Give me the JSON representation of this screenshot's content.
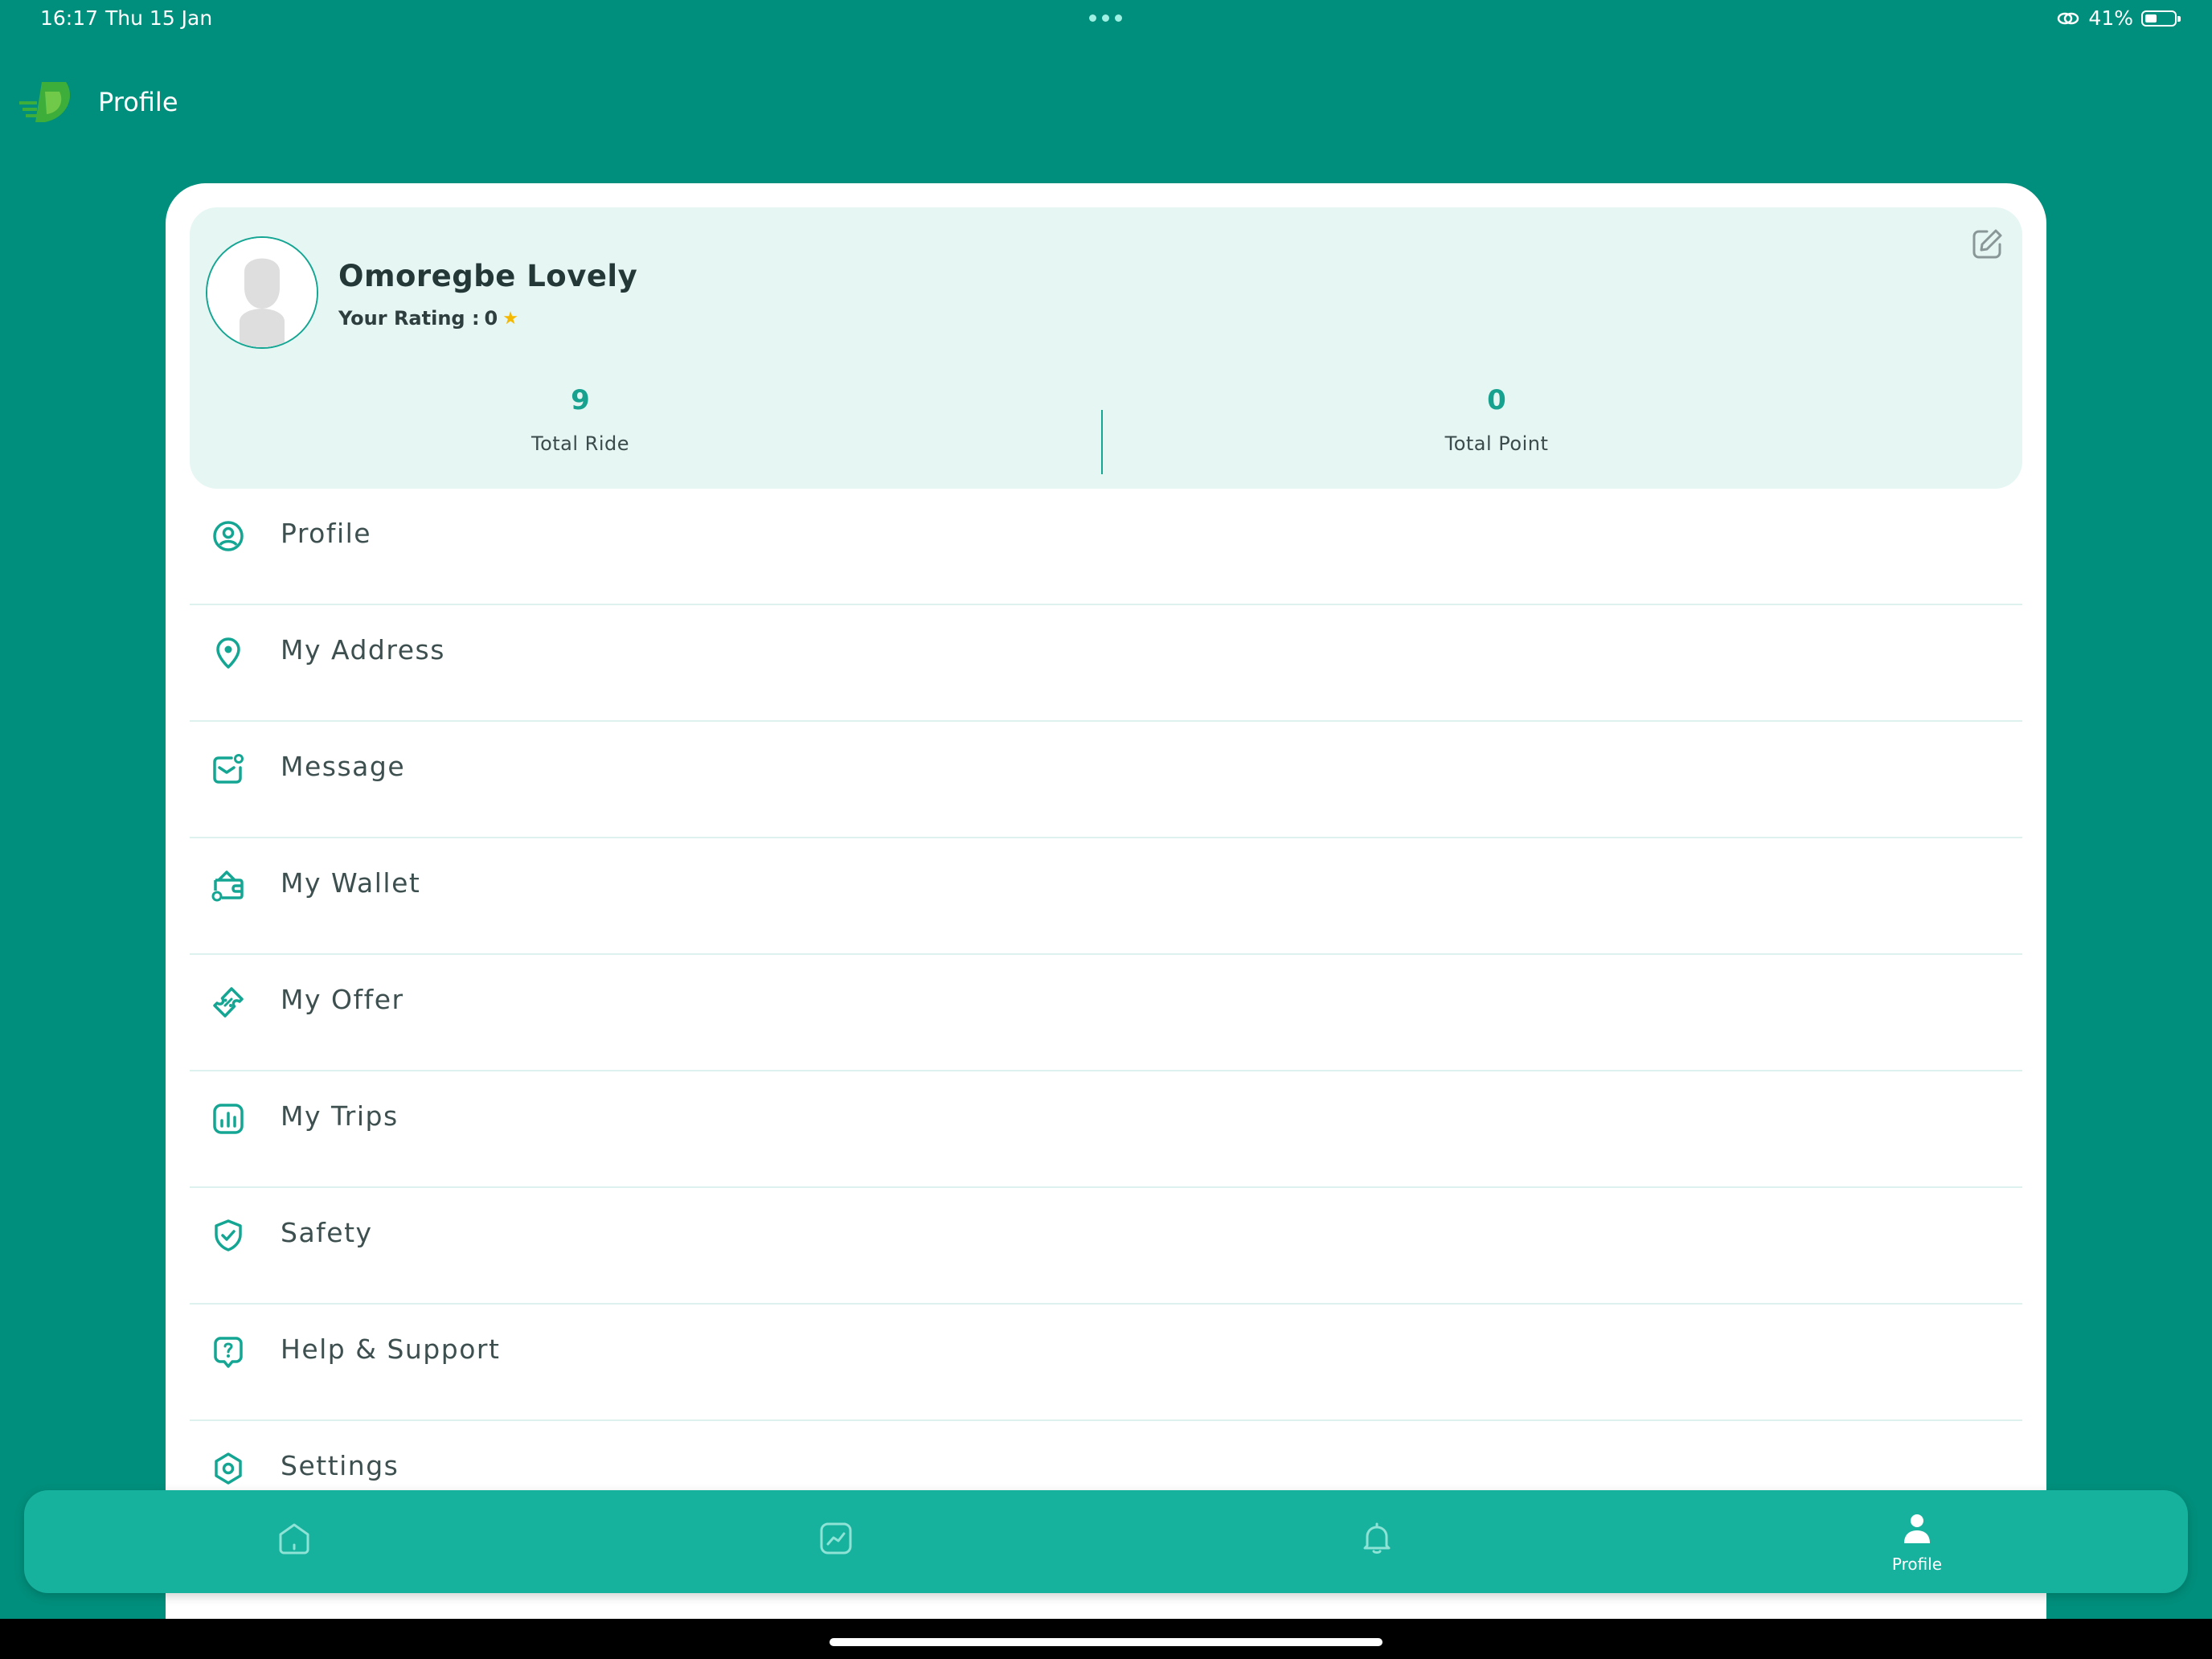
{
  "status_bar": {
    "time": "16:17",
    "date": "Thu 15 Jan",
    "battery": "41%",
    "battery_level": 0.41
  },
  "header": {
    "title": "Profile",
    "logo_icon": "app-logo-icon"
  },
  "profile": {
    "name": "Omoregbe Lovely",
    "rating_label": "Your Rating :",
    "rating_value": "0",
    "rating_icon": "star-icon",
    "stats": [
      {
        "value": "9",
        "label": "Total Ride"
      },
      {
        "value": "0",
        "label": "Total Point"
      }
    ]
  },
  "menu": {
    "items": [
      {
        "label": "Profile",
        "icon": "user-circle-icon"
      },
      {
        "label": "My Address",
        "icon": "location-pin-icon"
      },
      {
        "label": "Message",
        "icon": "message-icon"
      },
      {
        "label": "My Wallet",
        "icon": "wallet-icon"
      },
      {
        "label": "My Offer",
        "icon": "ticket-icon"
      },
      {
        "label": "My Trips",
        "icon": "trips-chart-icon"
      },
      {
        "label": "Safety",
        "icon": "shield-check-icon"
      },
      {
        "label": "Help & Support",
        "icon": "help-icon"
      },
      {
        "label": "Settings",
        "icon": "settings-icon"
      }
    ]
  },
  "bottom_nav": {
    "items": [
      {
        "label": "",
        "icon": "home-icon"
      },
      {
        "label": "",
        "icon": "activity-chart-icon"
      },
      {
        "label": "",
        "icon": "bell-icon"
      },
      {
        "label": "Profile",
        "icon": "profile-icon",
        "active": true
      }
    ]
  },
  "colors": {
    "background": "#008F7C",
    "accent": "#14A593",
    "nav_bar": "#16B29E",
    "summary_bg": "#E5F6F3",
    "star": "#F5B800"
  }
}
